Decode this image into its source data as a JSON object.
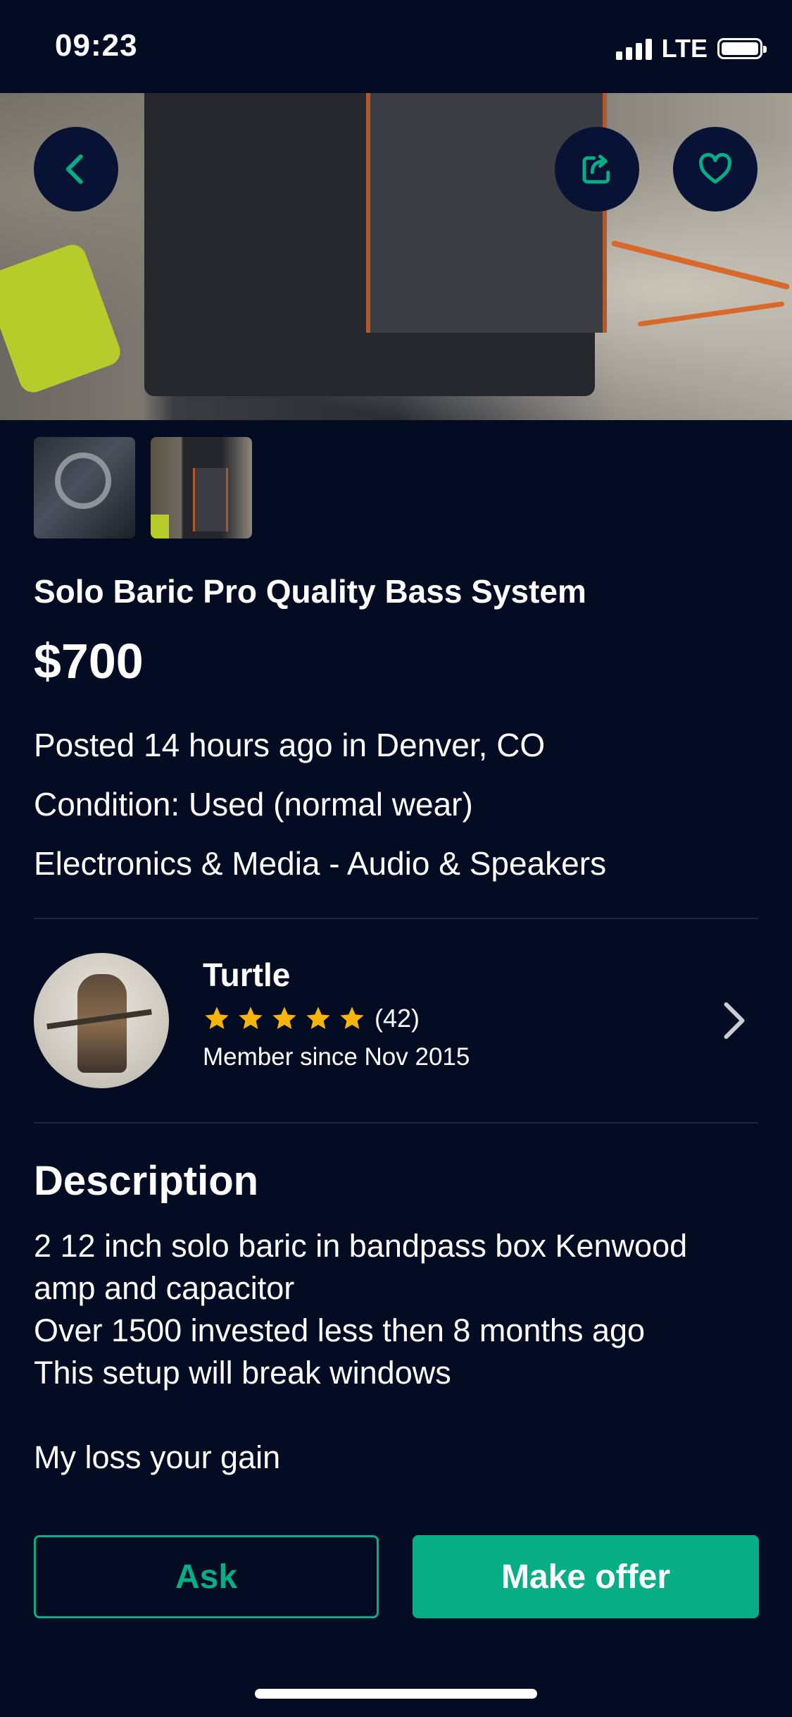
{
  "status_bar": {
    "time": "09:23",
    "network": "LTE"
  },
  "listing": {
    "title": "Solo Baric Pro Quality Bass System",
    "price": "$700",
    "posted": "Posted 14 hours ago in Denver, CO",
    "condition": "Condition: Used (normal wear)",
    "category": "Electronics & Media - Audio & Speakers",
    "photos": [
      "photo-thumbnail-1",
      "photo-thumbnail-2"
    ]
  },
  "seller": {
    "name": "Turtle",
    "stars": 5,
    "rating_count": "(42)",
    "member_since": "Member since Nov 2015"
  },
  "description": {
    "heading": "Description",
    "lines": [
      "2 12  inch solo baric in bandpass box Kenwood",
      "amp and capacitor",
      "Over 1500 invested less then 8 months ago",
      "This setup will break windows",
      "",
      "My loss your gain"
    ]
  },
  "actions": {
    "ask_label": "Ask",
    "offer_label": "Make offer"
  },
  "icons": {
    "back": "chevron-left-icon",
    "share": "share-icon",
    "favorite": "heart-icon",
    "seller_link": "chevron-right-icon"
  },
  "colors": {
    "background": "#040c24",
    "accent": "#07ad84",
    "star": "#f5b50a"
  }
}
